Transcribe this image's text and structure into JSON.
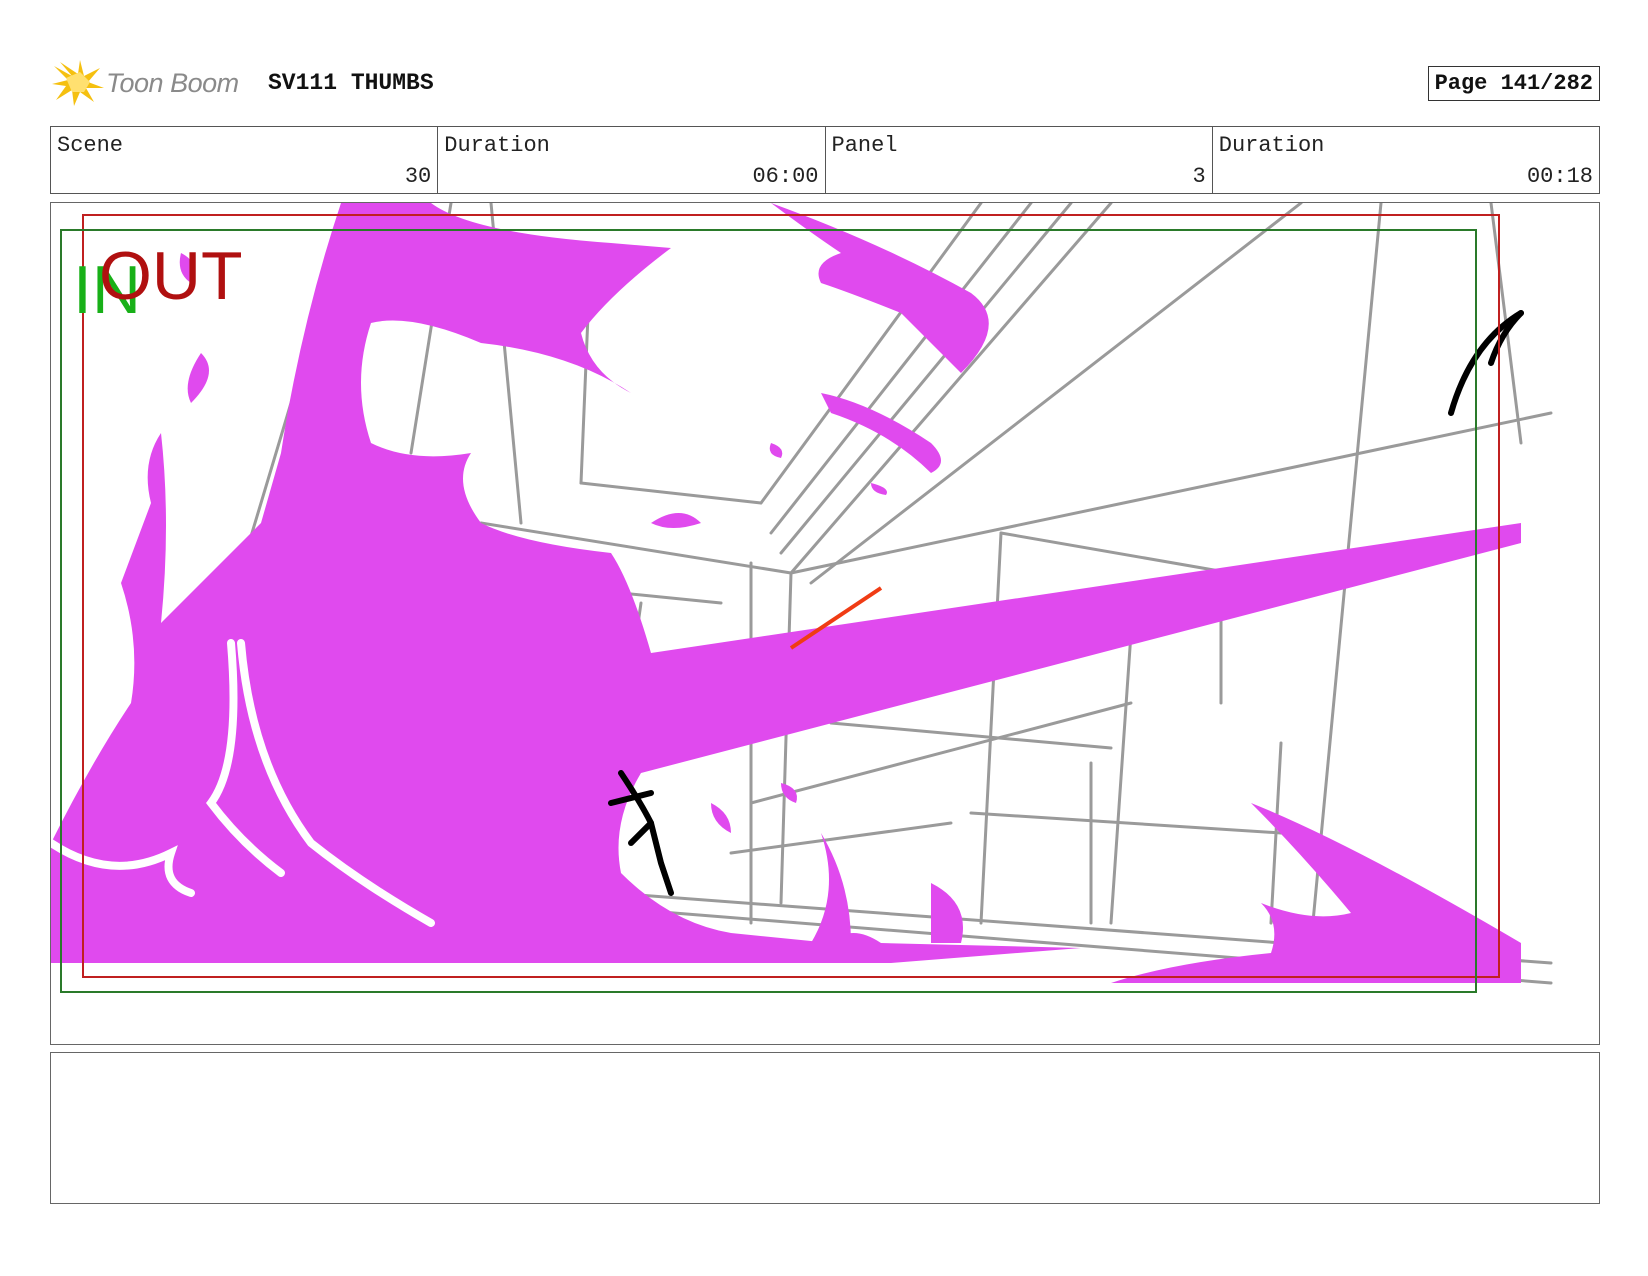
{
  "header": {
    "logo_text": "Toon Boom",
    "project_title": "SV111 THUMBS",
    "page_label": "Page 141/282"
  },
  "info": {
    "scene": {
      "label": "Scene",
      "value": "30"
    },
    "scene_duration": {
      "label": "Duration",
      "value": "06:00"
    },
    "panel": {
      "label": "Panel",
      "value": "3"
    },
    "panel_duration": {
      "label": "Duration",
      "value": "00:18"
    }
  },
  "panel_image": {
    "in_marker": "IN",
    "out_marker": "OUT",
    "colors": {
      "magenta": "#e04aee",
      "in_green": "#18b018",
      "out_red": "#b01010",
      "frame_red": "#c02020",
      "frame_green": "#2a7a2a",
      "sketch_gray": "#9a9a9a",
      "accent_orange": "#f03c14"
    }
  },
  "notes": {
    "text": ""
  }
}
